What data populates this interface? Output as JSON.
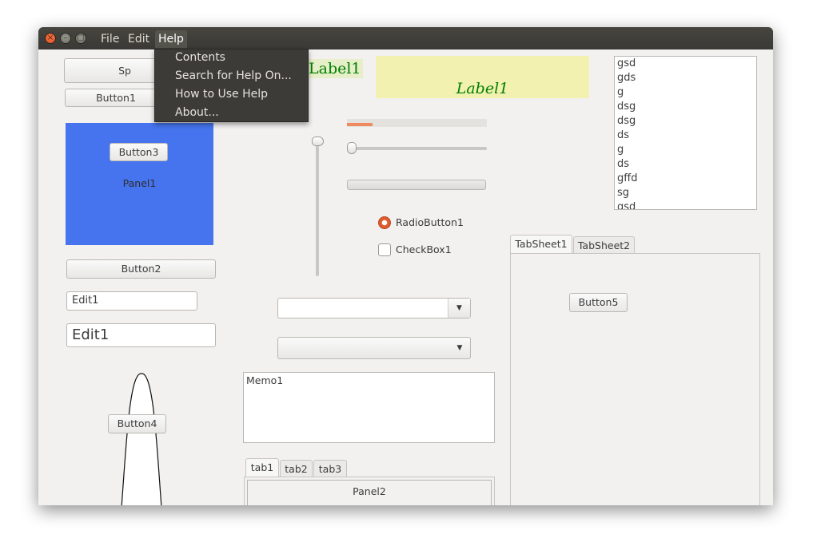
{
  "menubar": {
    "file": "File",
    "edit": "Edit",
    "help": "Help"
  },
  "help_menu": {
    "items": [
      "Contents",
      "Search for Help On...",
      "How to Use Help",
      "About..."
    ]
  },
  "speed_button": {
    "label": "Sp"
  },
  "button1": {
    "label": "Button1"
  },
  "panel1": {
    "label": "Panel1",
    "color": "#4674ee"
  },
  "button3": {
    "label": "Button3"
  },
  "button2": {
    "label": "Button2"
  },
  "edit_small": {
    "value": "Edit1"
  },
  "edit_large": {
    "value": "Edit1"
  },
  "button4": {
    "label": "Button4"
  },
  "label_plain": {
    "text": "Label1",
    "color": "#008000"
  },
  "label_box": {
    "text": "Label1",
    "bg": "#f3f1b0"
  },
  "progress": {
    "value": 0.18
  },
  "hslider": {
    "value": 0.0
  },
  "vslider": {
    "value": 0.0
  },
  "radio1": {
    "label": "RadioButton1",
    "checked": true
  },
  "checkbox1": {
    "label": "CheckBox1",
    "checked": false
  },
  "combo1": {
    "value": ""
  },
  "combo2": {
    "value": ""
  },
  "memo1": {
    "text": "Memo1"
  },
  "bottom_tabs": {
    "tabs": [
      "tab1",
      "tab2",
      "tab3"
    ],
    "active": 0,
    "panel_label": "Panel2"
  },
  "listbox": {
    "items": [
      "gsd",
      "gds",
      "g",
      "dsg",
      "dsg",
      "ds",
      "g",
      "ds",
      "gffd",
      "sg",
      "gsd"
    ]
  },
  "pagecontrol": {
    "tabs": [
      "TabSheet1",
      "TabSheet2"
    ],
    "active": 0,
    "button_label": "Button5"
  }
}
